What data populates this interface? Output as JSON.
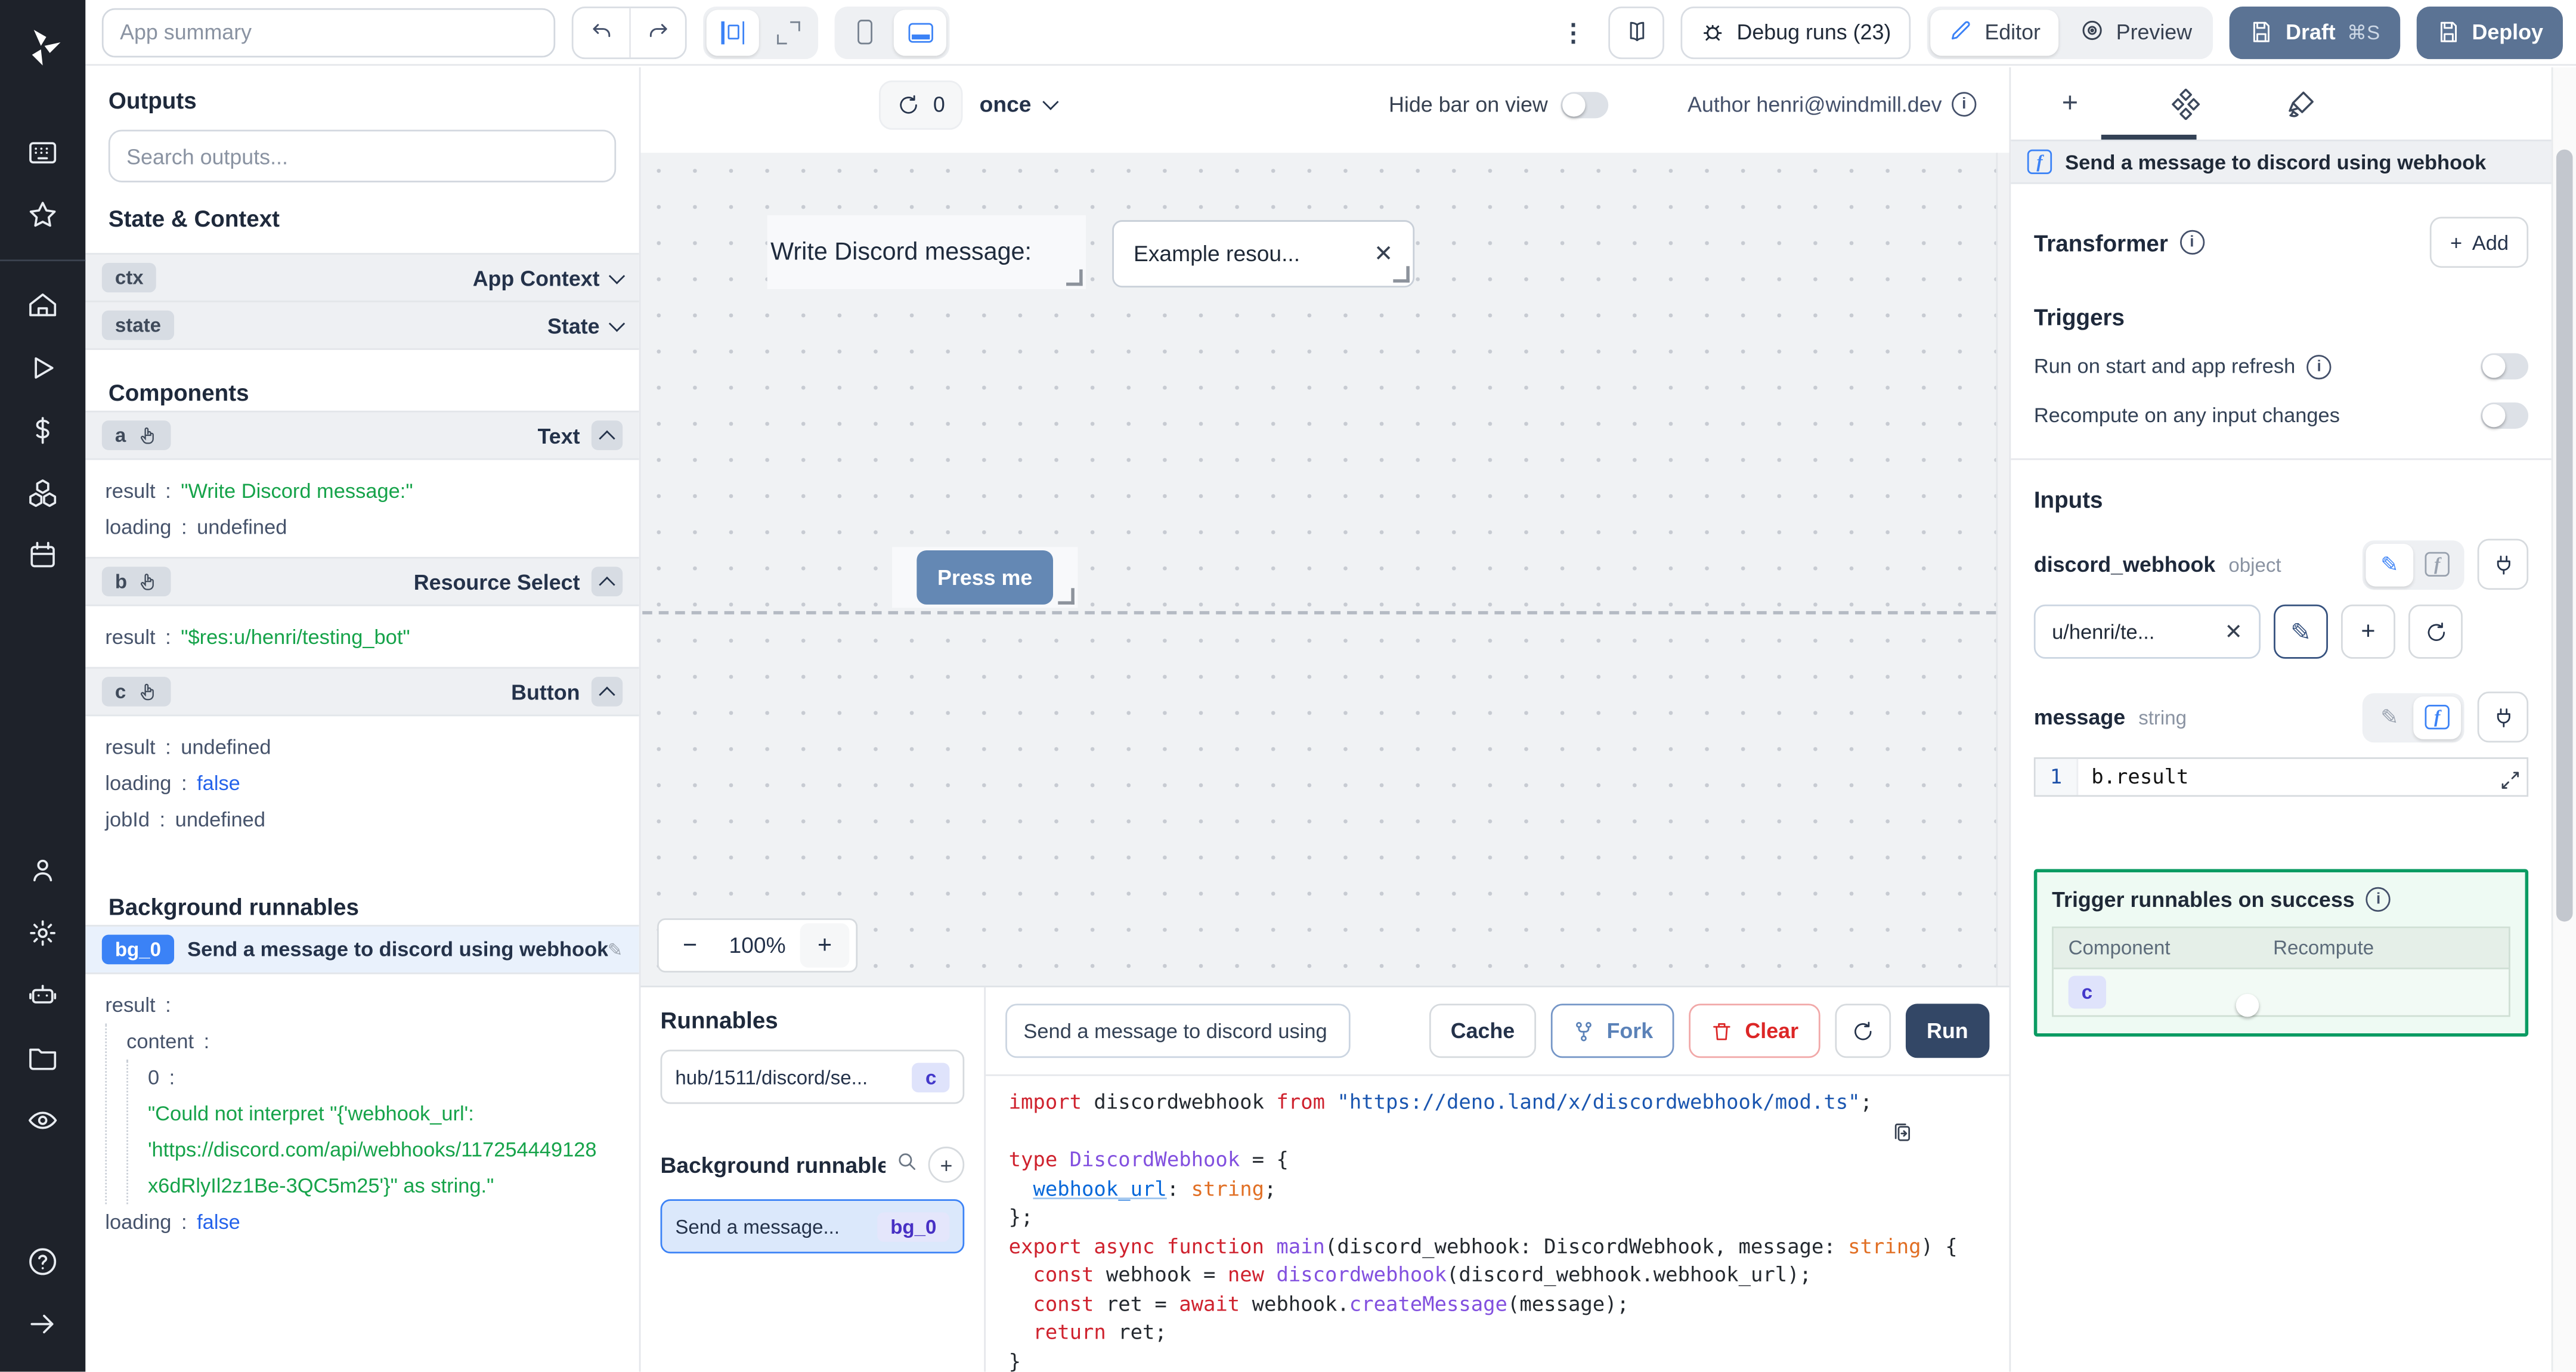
{
  "icons": {
    "kebab": "⋮",
    "close": "✕",
    "pencil": "✎",
    "info": "i",
    "plus": "+"
  },
  "topbar": {
    "app_summary_placeholder": "App summary",
    "debug_runs": "Debug runs (23)",
    "editor": "Editor",
    "preview": "Preview",
    "draft": "Draft",
    "draft_shortcut": "⌘S",
    "deploy": "Deploy"
  },
  "center_toolbar": {
    "refresh_count": "0",
    "schedule": "once",
    "hide_bar_label": "Hide bar on view",
    "author": "Author henri@windmill.dev"
  },
  "canvas": {
    "text_component": "Write Discord message:",
    "select_value": "Example resou...",
    "button_label": "Press me",
    "zoom_out": "−",
    "zoom_level": "100%",
    "zoom_in": "+"
  },
  "outputs": {
    "title": "Outputs",
    "search_placeholder": "Search outputs...",
    "state_context_title": "State & Context",
    "ctx_key": "ctx",
    "ctx_label": "App Context",
    "state_key": "state",
    "state_label": "State",
    "components_title": "Components",
    "a_key": "a",
    "a_type": "Text",
    "a_result_key": "result",
    "a_result_val": "\"Write Discord message:\"",
    "a_loading_key": "loading",
    "a_loading_val": "undefined",
    "b_key": "b",
    "b_type": "Resource Select",
    "b_result_key": "result",
    "b_result_val": "\"$res:u/henri/testing_bot\"",
    "c_key": "c",
    "c_type": "Button",
    "c_result_key": "result",
    "c_result_val": "undefined",
    "c_loading_key": "loading",
    "c_loading_val": "false",
    "c_jobid_key": "jobId",
    "c_jobid_val": "undefined",
    "bg_title": "Background runnables",
    "bg0_key": "bg_0",
    "bg0_title": "Send a message to discord using webhook",
    "bg0_result_key": "result",
    "bg0_content_key": "content",
    "bg0_index_key": "0",
    "bg0_error_line1": "\"Could not interpret \"{'webhook_url':",
    "bg0_error_line2": "'https://discord.com/api/webhooks/117254449128",
    "bg0_error_line3": "x6dRlyIl2z1Be-3QC5m25'}\" as string.\"",
    "bg0_loading_key": "loading",
    "bg0_loading_val": "false"
  },
  "runnables": {
    "title": "Runnables",
    "item_path": "hub/1511/discord/se...",
    "item_badge": "c",
    "bg_title": "Background runnables",
    "bg_item_label": "Send a message...",
    "bg_item_badge": "bg_0"
  },
  "editor": {
    "name_value": "Send a message to discord using",
    "cache": "Cache",
    "fork": "Fork",
    "clear": "Clear",
    "run": "Run",
    "code": [
      [
        {
          "t": "import ",
          "c": "k"
        },
        {
          "t": "discordwebhook ",
          "c": "d"
        },
        {
          "t": "from ",
          "c": "k"
        },
        {
          "t": "\"https://deno.land/x/discordwebhook/mod.ts\"",
          "c": "s"
        },
        {
          "t": ";",
          "c": "d"
        }
      ],
      [],
      [
        {
          "t": "type ",
          "c": "k"
        },
        {
          "t": "DiscordWebhook ",
          "c": "t"
        },
        {
          "t": "= {",
          "c": "d"
        }
      ],
      [
        {
          "t": "  ",
          "c": "d"
        },
        {
          "t": "webhook_url",
          "c": "v"
        },
        {
          "t": ": ",
          "c": "d"
        },
        {
          "t": "string",
          "c": "o"
        },
        {
          "t": ";",
          "c": "d"
        }
      ],
      [
        {
          "t": "};",
          "c": "d"
        }
      ],
      [
        {
          "t": "export async function ",
          "c": "k"
        },
        {
          "t": "main",
          "c": "t"
        },
        {
          "t": "(discord_webhook: DiscordWebhook, message: ",
          "c": "d"
        },
        {
          "t": "string",
          "c": "o"
        },
        {
          "t": ") {",
          "c": "d"
        }
      ],
      [
        {
          "t": "  const ",
          "c": "k"
        },
        {
          "t": "webhook = ",
          "c": "d"
        },
        {
          "t": "new ",
          "c": "k"
        },
        {
          "t": "discordwebhook",
          "c": "t"
        },
        {
          "t": "(discord_webhook.webhook_url);",
          "c": "d"
        }
      ],
      [
        {
          "t": "  const ",
          "c": "k"
        },
        {
          "t": "ret = ",
          "c": "d"
        },
        {
          "t": "await ",
          "c": "k"
        },
        {
          "t": "webhook.",
          "c": "d"
        },
        {
          "t": "createMessage",
          "c": "t"
        },
        {
          "t": "(message);",
          "c": "d"
        }
      ],
      [
        {
          "t": "  return ",
          "c": "k"
        },
        {
          "t": "ret;",
          "c": "d"
        }
      ],
      [
        {
          "t": "}",
          "c": "d"
        }
      ]
    ]
  },
  "rightpanel": {
    "header": "Send a message to discord using webhook",
    "transformer": "Transformer",
    "add": "Add",
    "triggers_title": "Triggers",
    "trigger1": "Run on start and app refresh",
    "trigger2": "Recompute on any input changes",
    "inputs_title": "Inputs",
    "input1_name": "discord_webhook",
    "input1_type": "object",
    "input1_value": "u/henri/te...",
    "input2_name": "message",
    "input2_type": "string",
    "input2_lineno": "1",
    "input2_expr": "b.result",
    "success_title": "Trigger runnables on success",
    "success_col1": "Component",
    "success_col2": "Recompute",
    "success_row_badge": "c"
  }
}
